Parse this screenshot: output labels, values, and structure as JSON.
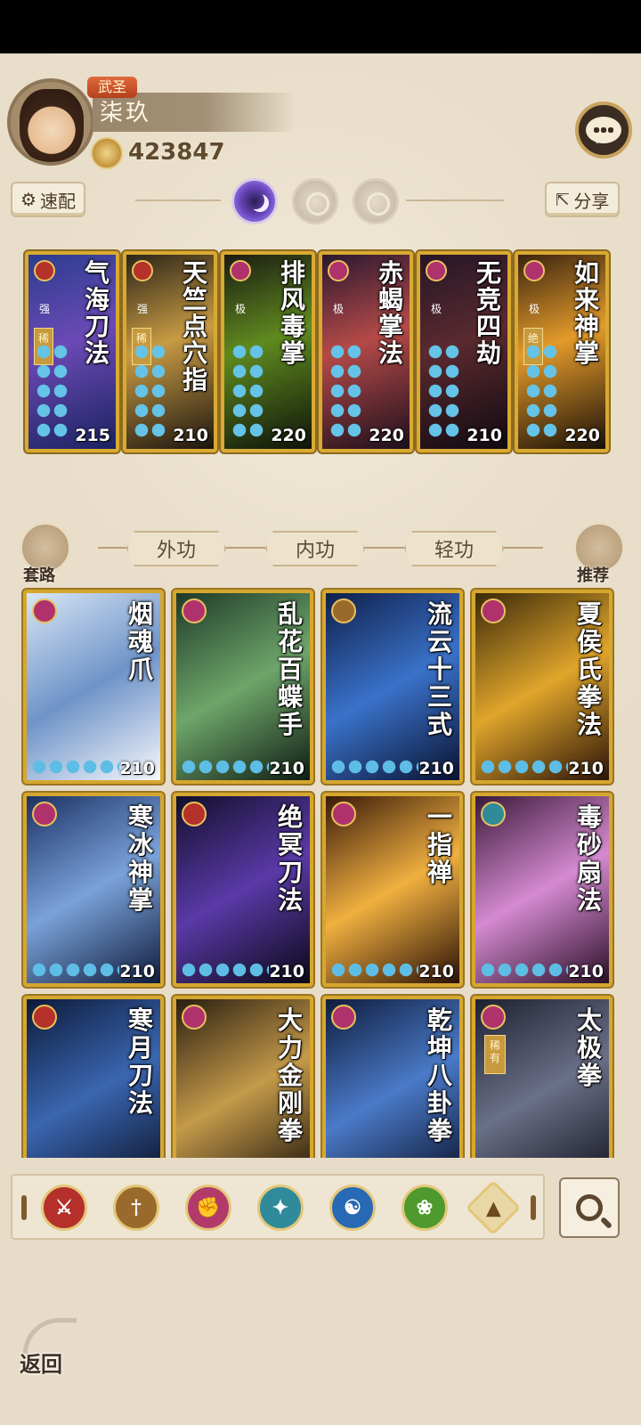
{
  "player": {
    "rank": "武圣",
    "name": "柒玖",
    "power": "423847"
  },
  "toolbar": {
    "quick_match": "速配",
    "share": "分享"
  },
  "equipped": [
    {
      "title": "气海刀法",
      "grade": "强",
      "tag": "稀有",
      "value": "215",
      "color": "#b4322a"
    },
    {
      "title": "天竺点穴指",
      "grade": "强",
      "tag": "稀有",
      "value": "210",
      "color": "#b4322a"
    },
    {
      "title": "排风毒掌",
      "grade": "极",
      "tag": "",
      "value": "220",
      "color": "#b0326d"
    },
    {
      "title": "赤蝎掌法",
      "grade": "极",
      "tag": "",
      "value": "220",
      "color": "#b0326d"
    },
    {
      "title": "无竞四劫",
      "grade": "极",
      "tag": "",
      "value": "210",
      "color": "#b0326d"
    },
    {
      "title": "如来神掌",
      "grade": "极",
      "tag": "绝世",
      "value": "220",
      "color": "#b0326d"
    }
  ],
  "side_buttons": {
    "set": "套路",
    "recommend": "推荐"
  },
  "tabs": [
    {
      "label": "外功",
      "active": true
    },
    {
      "label": "内功",
      "active": false
    },
    {
      "label": "轻功",
      "active": false
    }
  ],
  "skills": [
    {
      "title": "烟魂爪",
      "value": "210",
      "tag": ""
    },
    {
      "title": "乱花百蝶手",
      "value": "210",
      "tag": ""
    },
    {
      "title": "流云十三式",
      "value": "210",
      "tag": ""
    },
    {
      "title": "夏侯氏拳法",
      "value": "210",
      "tag": ""
    },
    {
      "title": "寒冰神掌",
      "value": "210",
      "tag": ""
    },
    {
      "title": "绝冥刀法",
      "value": "210",
      "tag": ""
    },
    {
      "title": "一指禅",
      "value": "210",
      "tag": ""
    },
    {
      "title": "毒砂扇法",
      "value": "210",
      "tag": ""
    },
    {
      "title": "寒月刀法",
      "value": "",
      "tag": ""
    },
    {
      "title": "大力金刚拳",
      "value": "",
      "tag": ""
    },
    {
      "title": "乾坤八卦拳",
      "value": "",
      "tag": ""
    },
    {
      "title": "太极拳",
      "value": "",
      "tag": "稀有"
    }
  ],
  "filters": [
    {
      "icon": "blade-icon",
      "color": "#b5302a"
    },
    {
      "icon": "sword-icon",
      "color": "#9a6a2c"
    },
    {
      "icon": "fist-icon",
      "color": "#b23a6a"
    },
    {
      "icon": "fan-icon",
      "color": "#2f8a9a"
    },
    {
      "icon": "taiji-icon",
      "color": "#2869b3"
    },
    {
      "icon": "whip-icon",
      "color": "#4e9a2e"
    },
    {
      "icon": "up-arrow-icon",
      "color": "#e9d7a6"
    }
  ],
  "back_label": "返回"
}
